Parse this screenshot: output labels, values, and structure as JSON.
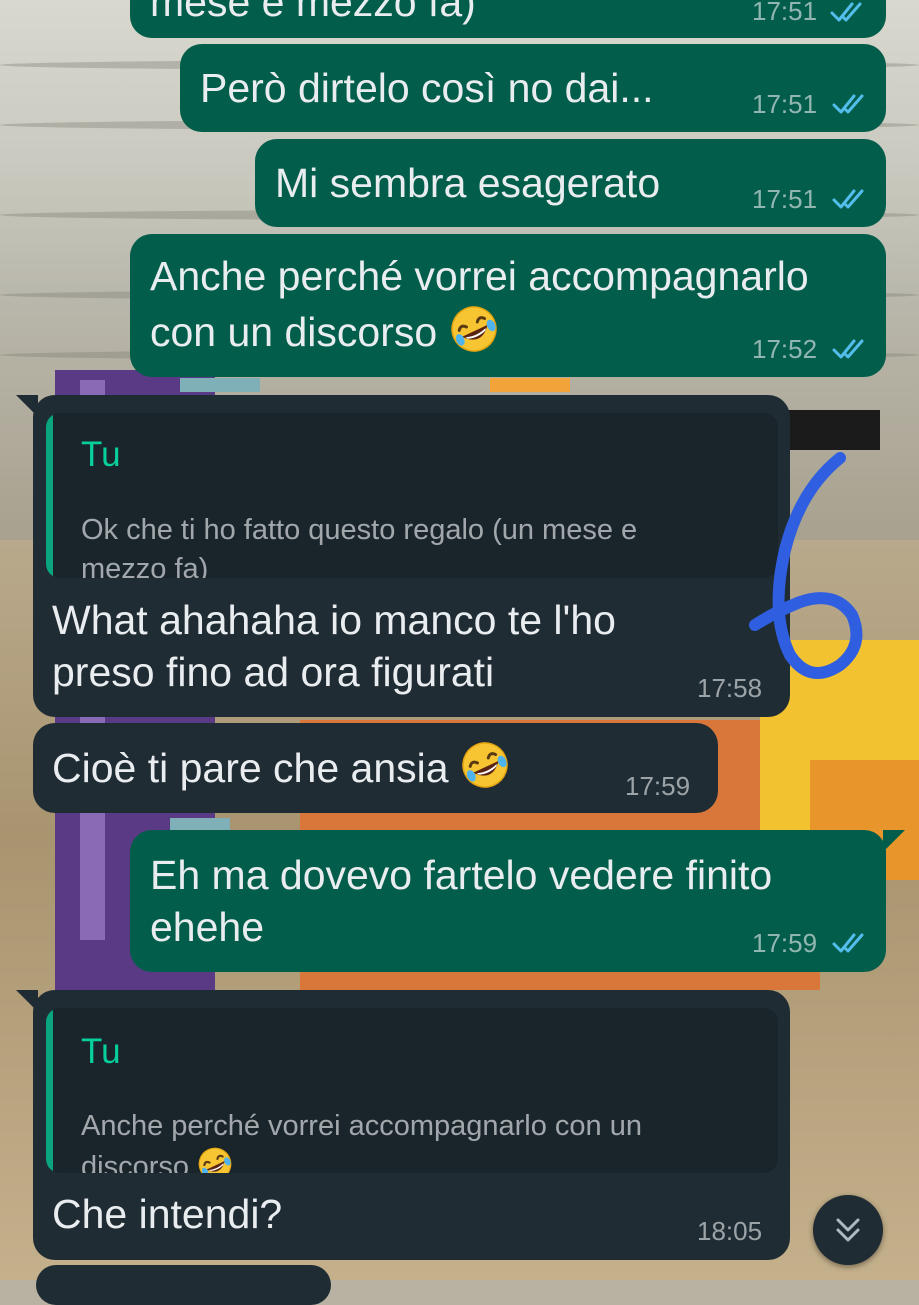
{
  "messages": [
    {
      "id": "m0",
      "direction": "outgoing",
      "text": "mese e mezzo fa)",
      "time": "17:51",
      "status": "read"
    },
    {
      "id": "m1",
      "direction": "outgoing",
      "text": "Però dirtelo così no dai...",
      "time": "17:51",
      "status": "read"
    },
    {
      "id": "m2",
      "direction": "outgoing",
      "text": "Mi sembra esagerato",
      "time": "17:51",
      "status": "read"
    },
    {
      "id": "m3",
      "direction": "outgoing",
      "line1": "Anche perché vorrei accompagnarlo",
      "line2": "con un discorso",
      "emoji": "rolling-on-floor-laughing",
      "time": "17:52",
      "status": "read"
    },
    {
      "id": "m4",
      "direction": "incoming",
      "quote": {
        "author": "Tu",
        "line1": "Ok che ti ho fatto questo regalo (un mese e",
        "line2": "mezzo fa)"
      },
      "line1": "What ahahaha io manco te l'ho",
      "line2": "preso fino ad ora figurati",
      "time": "17:58"
    },
    {
      "id": "m5",
      "direction": "incoming",
      "text": "Cioè ti pare che ansia",
      "emoji": "rolling-on-floor-laughing",
      "time": "17:59"
    },
    {
      "id": "m6",
      "direction": "outgoing",
      "line1": "Eh ma dovevo fartelo vedere finito",
      "line2": "ehehe",
      "time": "17:59",
      "status": "read"
    },
    {
      "id": "m7",
      "direction": "incoming",
      "quote": {
        "author": "Tu",
        "line1": "Anche perché vorrei accompagnarlo con un",
        "line2": "discorso",
        "emoji": "rolling-on-floor-laughing"
      },
      "text": "Che intendi?",
      "time": "18:05"
    }
  ],
  "annotation": {
    "text": "6",
    "color": "#2f5fe0"
  },
  "scroll_button": {
    "icon": "double-chevron-down-icon"
  },
  "colors": {
    "outgoing_bubble": "#035d4b",
    "incoming_bubble": "#1f2c33",
    "quote_accent": "#06cf9c",
    "read_ticks": "#53bdeb"
  }
}
